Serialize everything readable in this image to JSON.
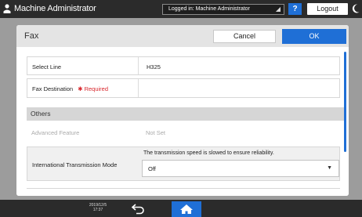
{
  "topbar": {
    "user_icon": "user-icon",
    "title": "Machine Administrator",
    "login_status": "Logged in: Machine Administrator",
    "help_label": "?",
    "logout_label": "Logout",
    "moon_icon": "moon-icon"
  },
  "dialog": {
    "title": "Fax",
    "cancel_label": "Cancel",
    "ok_label": "OK"
  },
  "rows": {
    "select_line": {
      "label": "Select Line",
      "value": "H325"
    },
    "fax_destination": {
      "label": "Fax Destination",
      "required": "✱ Required",
      "value": ""
    },
    "others_header": "Others",
    "advanced_feature": {
      "label": "Advanced Feature",
      "value": "Not Set"
    },
    "international": {
      "label": "International Transmission Mode",
      "note": "The transmission speed is slowed to ensure reliability.",
      "value": "Off"
    }
  },
  "bottombar": {
    "date": "2019/12/5",
    "time": "17:37",
    "back_icon": "back-icon",
    "home_icon": "home-icon"
  },
  "colors": {
    "accent": "#1f6fd6",
    "required": "#d8262c",
    "bar": "#2b2b2b",
    "frame": "#9c9c9c"
  }
}
